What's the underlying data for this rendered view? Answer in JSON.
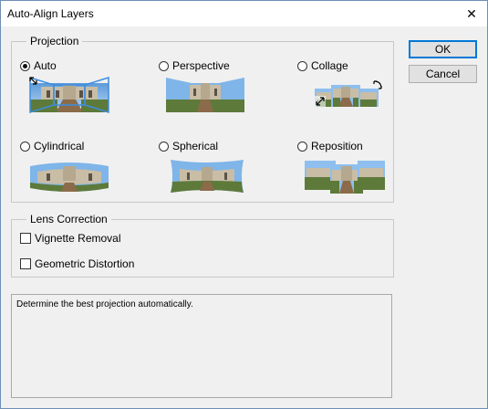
{
  "window": {
    "title": "Auto-Align Layers",
    "close_glyph": "✕"
  },
  "projection": {
    "legend": "Projection",
    "options": [
      {
        "label": "Auto",
        "selected": true
      },
      {
        "label": "Perspective",
        "selected": false
      },
      {
        "label": "Collage",
        "selected": false
      },
      {
        "label": "Cylindrical",
        "selected": false
      },
      {
        "label": "Spherical",
        "selected": false
      },
      {
        "label": "Reposition",
        "selected": false
      }
    ]
  },
  "lens_correction": {
    "legend": "Lens Correction",
    "options": [
      {
        "label": "Vignette Removal",
        "checked": false
      },
      {
        "label": "Geometric Distortion",
        "checked": false
      }
    ]
  },
  "buttons": {
    "ok": "OK",
    "cancel": "Cancel"
  },
  "description": "Determine the best projection automatically.",
  "colors": {
    "accent": "#0078d7",
    "selection_blue": "#3d8ee0",
    "sky": "#6aa7e0",
    "building": "#c9bda6"
  },
  "icons": [
    "close-icon",
    "resize-arrow-icon",
    "rotate-arrow-icon"
  ]
}
